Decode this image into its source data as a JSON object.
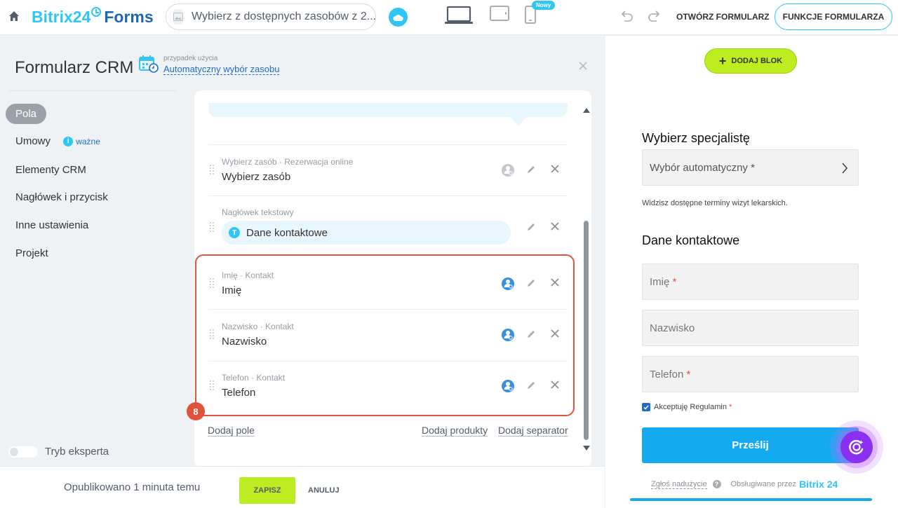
{
  "topbar": {
    "logo_brand": "Bitrix24",
    "logo_product": "Forms",
    "resource_select": "Wybierz z dostępnych zasobów z 2...",
    "new_badge": "Nowy",
    "open_form": "OTWÓRZ FORMULARZ",
    "form_functions": "FUNKCJE FORMULARZA"
  },
  "sidebar": {
    "title": "Formularz CRM",
    "usecase_label": "przypadek użycia",
    "usecase_value": "Automatyczny wybór zasobu",
    "nav": [
      {
        "label": "Pola"
      },
      {
        "label": "Umowy"
      },
      {
        "label": "Elementy CRM"
      },
      {
        "label": "Nagłówek i przycisk"
      },
      {
        "label": "Inne ustawienia"
      },
      {
        "label": "Projekt"
      }
    ],
    "important_label": "ważne",
    "expert_mode": "Tryb eksperta"
  },
  "fields": {
    "rows": [
      {
        "subtitle": "Wybierz zasób · Rezerwacja online",
        "name": "Wybierz zasób"
      },
      {
        "subtitle": "Nagłówek tekstowy",
        "name": "Dane kontaktowe"
      },
      {
        "subtitle": "Imię · Kontakt",
        "name": "Imię"
      },
      {
        "subtitle": "Nazwisko · Kontakt",
        "name": "Nazwisko"
      },
      {
        "subtitle": "Telefon · Kontakt",
        "name": "Telefon"
      }
    ],
    "step_badge": "8",
    "add_field": "Dodaj pole",
    "add_products": "Dodaj produkty",
    "add_separator": "Dodaj separator"
  },
  "bottom": {
    "published": "Opublikowano 1 minuta temu",
    "save": "ZAPISZ",
    "cancel": "ANULUJ"
  },
  "preview": {
    "add_block": "DODAJ BLOK",
    "specialist_heading": "Wybierz specjalistę",
    "specialist_select": "Wybór automatyczny",
    "required_mark": "*",
    "hint": "Widzisz dostępne terminy wizyt lekarskich.",
    "contact_heading": "Dane kontaktowe",
    "first_name": "Imię",
    "last_name": "Nazwisko",
    "phone": "Telefon",
    "accept_terms": "Akceptuję Regulamin",
    "submit": "Prześlij",
    "report": "Zgłoś nadużycie",
    "powered_by": "Obsługiwane przez",
    "powered_brand": "Bitrix 24"
  },
  "colors": {
    "accent": "#2fc6f6",
    "save_green": "#bbed21",
    "highlight_red": "#e0533b",
    "submit_blue": "#13aaf0",
    "link_blue": "#1e6ec8"
  }
}
